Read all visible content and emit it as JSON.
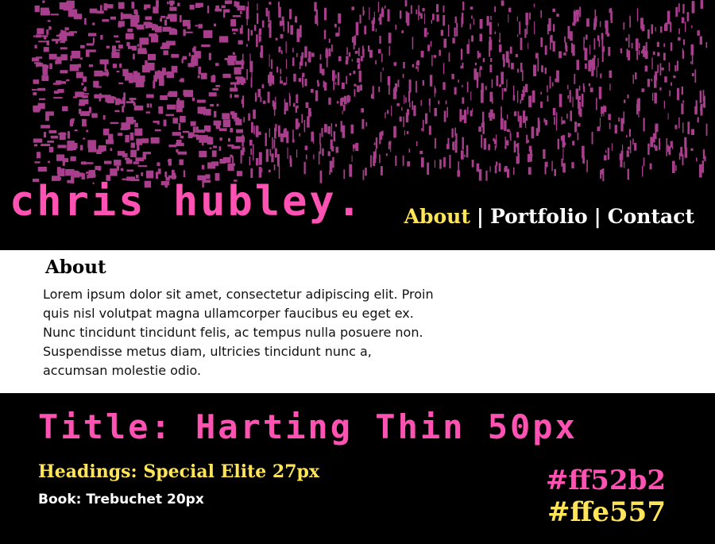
{
  "header": {
    "site_title": "chris hubley.",
    "nav": [
      {
        "label": "About"
      },
      {
        "label": "Portfolio"
      },
      {
        "label": "Contact"
      }
    ],
    "nav_separator": "|"
  },
  "about": {
    "heading": "About",
    "body": "Lorem ipsum dolor sit amet, consectetur adipiscing elit. Proin quis nisl volutpat magna ullamcorper faucibus eu eget ex. Nunc tincidunt tincidunt felis, ac tempus nulla posuere non. Suspendisse metus diam, ultricies tincidunt nunc a, accumsan molestie odio."
  },
  "style_guide": {
    "title_font": "Title: Harting Thin 50px",
    "heading_font": "Headings: Special Elite 27px",
    "book_font": "Book: Trebuchet 20px",
    "color_primary": "#ff52b2",
    "color_secondary": "#ffe557"
  },
  "colors": {
    "pink": "#ff52b2",
    "yellow": "#ffe557",
    "grunge": "#a83f8c",
    "white": "#ffffff",
    "black": "#000000"
  }
}
